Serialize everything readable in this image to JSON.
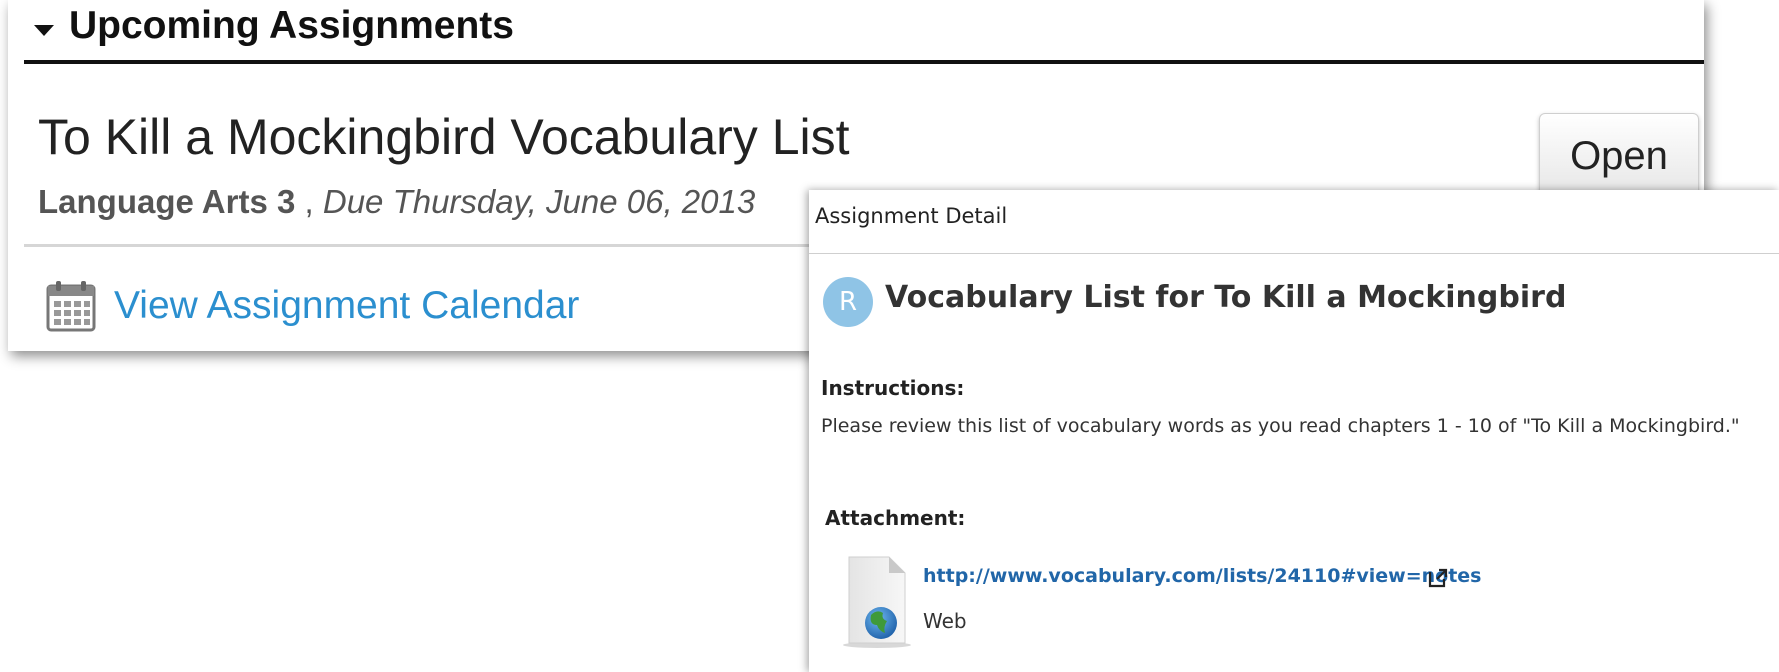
{
  "upcoming": {
    "title": "Upcoming Assignments",
    "assignment": {
      "title": "To Kill a Mockingbird Vocabulary List",
      "course": "Language Arts 3",
      "separator": " , ",
      "due": "Due Thursday, June 06, 2013",
      "open_label": "Open"
    },
    "calendar_link": "View Assignment Calendar"
  },
  "detail": {
    "header": "Assignment Detail",
    "avatar_letter": "R",
    "title": "Vocabulary List for To Kill a Mockingbird",
    "instructions_label": "Instructions:",
    "instructions_text": "Please review this list of vocabulary words as you read chapters 1 - 10 of \"To Kill a Mockingbird.\"",
    "attachment_label": "Attachment:",
    "attachment_url": "http://www.vocabulary.com/lists/24110#view=notes",
    "attachment_type": "Web"
  },
  "icons": {
    "collapse": "caret-down-icon",
    "calendar": "calendar-icon",
    "file": "web-file-icon",
    "external": "external-link-icon"
  },
  "colors": {
    "link": "#2b8fcf",
    "detail_link": "#2166a8",
    "avatar": "#8fc4e6"
  }
}
